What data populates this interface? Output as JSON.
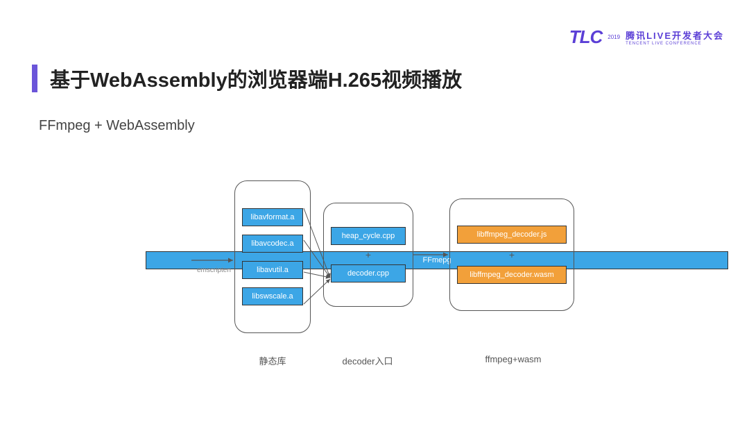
{
  "header": {
    "logo_text": "TLC",
    "logo_year": "2019",
    "logo_cn": "腾讯LIVE开发者大会",
    "logo_sub": "TENCENT LIVE CONFERENCE"
  },
  "title": "基于WebAssembly的浏览器端H.265视频播放",
  "subtitle": "FFmpeg + WebAssembly",
  "diagram": {
    "source": "FFmepg",
    "edge_label": "emscripten",
    "col1": {
      "items": [
        "libavformat.a",
        "libavcodec.a",
        "libavutil.a",
        "libswscale.a"
      ],
      "caption": "静态库"
    },
    "col2": {
      "items": [
        "heap_cycle.cpp",
        "decoder.cpp"
      ],
      "plus": "+",
      "caption": "decoder入口"
    },
    "col3": {
      "items": [
        "libffmpeg_decoder.js",
        "libffmpeg_decoder.wasm"
      ],
      "plus": "+",
      "caption": "ffmpeg+wasm"
    }
  }
}
